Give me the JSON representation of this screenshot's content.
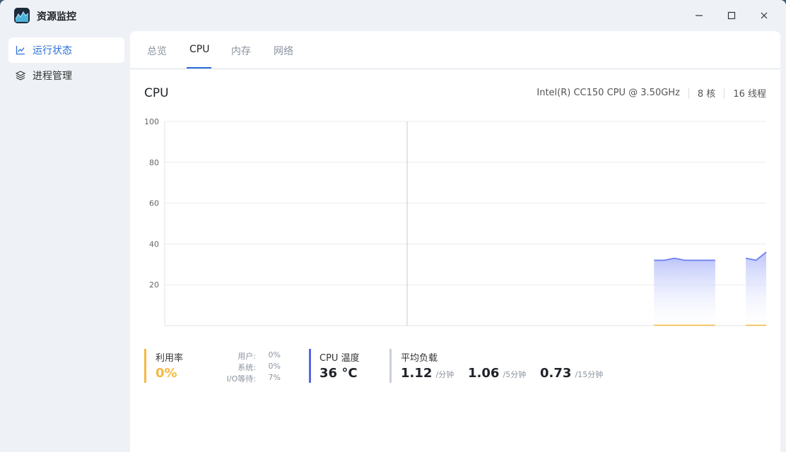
{
  "window": {
    "title": "资源监控",
    "controls": {
      "minimize": "—",
      "maximize": "☐",
      "close": "✕"
    }
  },
  "sidebar": {
    "items": [
      {
        "label": "运行状态",
        "icon": "line-chart-icon",
        "active": true
      },
      {
        "label": "进程管理",
        "icon": "layers-icon",
        "active": false
      }
    ]
  },
  "tabs": [
    {
      "label": "总览",
      "active": false
    },
    {
      "label": "CPU",
      "active": true
    },
    {
      "label": "内存",
      "active": false
    },
    {
      "label": "网络",
      "active": false
    }
  ],
  "cpu": {
    "title": "CPU",
    "model": "Intel(R) CC150 CPU @ 3.50GHz",
    "cores": "8 核",
    "threads": "16 线程"
  },
  "stats": {
    "utilization": {
      "label": "利用率",
      "value": "0%",
      "breakdown": [
        {
          "label": "用户:",
          "value": "0%"
        },
        {
          "label": "系统:",
          "value": "0%"
        },
        {
          "label": "I/O等待:",
          "value": "7%"
        }
      ]
    },
    "temperature": {
      "label": "CPU 温度",
      "value": "36 °C"
    },
    "load": {
      "label": "平均负载",
      "values": [
        {
          "value": "1.12",
          "unit": "/分钟"
        },
        {
          "value": "1.06",
          "unit": "/5分钟"
        },
        {
          "value": "0.73",
          "unit": "/15分钟"
        }
      ]
    }
  },
  "colors": {
    "accent": "#2d6fd6",
    "series_line": "#6c7ff0",
    "series_fill": "#c7cefb",
    "utilization": "#f5b942",
    "temperature": "#5567e8",
    "load": "#c9d0da"
  },
  "chart_data": {
    "type": "area",
    "ylim": [
      0,
      100
    ],
    "yticks": [
      "20",
      "40",
      "60",
      "80",
      "100"
    ],
    "x_count": 60,
    "series": [
      {
        "values": [
          null,
          null,
          null,
          null,
          null,
          null,
          null,
          null,
          null,
          null,
          null,
          null,
          null,
          null,
          null,
          null,
          null,
          null,
          null,
          null,
          null,
          null,
          null,
          null,
          null,
          null,
          null,
          null,
          null,
          null,
          null,
          null,
          null,
          null,
          null,
          null,
          null,
          null,
          null,
          null,
          null,
          null,
          null,
          null,
          null,
          null,
          null,
          null,
          32,
          32,
          33,
          32,
          32,
          32,
          32,
          null,
          null,
          33,
          32,
          36
        ]
      },
      {
        "values": [
          null,
          null,
          null,
          null,
          null,
          null,
          null,
          null,
          null,
          null,
          null,
          null,
          null,
          null,
          null,
          null,
          null,
          null,
          null,
          null,
          null,
          null,
          null,
          null,
          null,
          null,
          null,
          null,
          null,
          null,
          null,
          null,
          null,
          null,
          null,
          null,
          null,
          null,
          null,
          null,
          null,
          null,
          null,
          null,
          null,
          null,
          null,
          null,
          0,
          0,
          0,
          0,
          0,
          0,
          0,
          null,
          null,
          0,
          0,
          0
        ]
      }
    ],
    "grid": true
  }
}
